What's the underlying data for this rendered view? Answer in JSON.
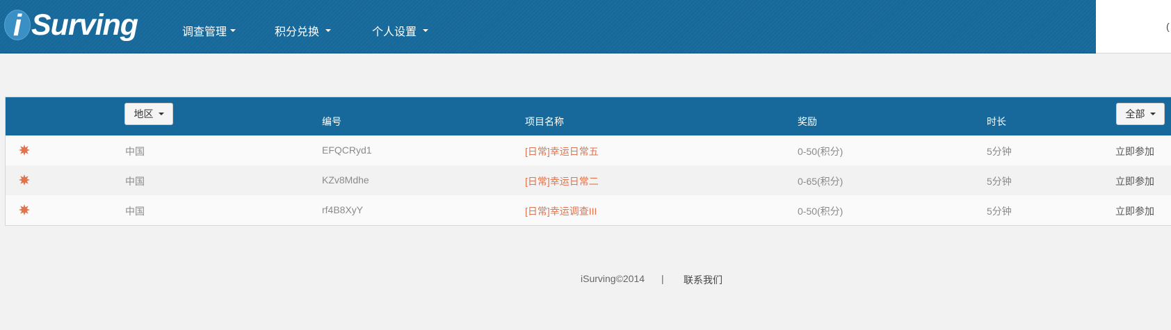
{
  "brand": {
    "logo_initial": "i",
    "logo_rest": "Surving"
  },
  "nav": [
    {
      "label": "调查管理"
    },
    {
      "label": "积分兑换"
    },
    {
      "label": "个人设置"
    }
  ],
  "header_right": {
    "edge_text": "("
  },
  "table": {
    "region_button": "地区",
    "filter_button": "全部",
    "columns": {
      "id": "编号",
      "name": "项目名称",
      "reward": "奖励",
      "duration": "时长"
    },
    "rows": [
      {
        "region": "中国",
        "id": "EFQCRyd1",
        "name": "[日常]幸运日常五",
        "reward": "0-50(积分)",
        "duration": "5分钟",
        "action": "立即参加"
      },
      {
        "region": "中国",
        "id": "KZv8Mdhe",
        "name": "[日常]幸运日常二",
        "reward": "0-65(积分)",
        "duration": "5分钟",
        "action": "立即参加"
      },
      {
        "region": "中国",
        "id": "rf4B8XyY",
        "name": "[日常]幸运调查III",
        "reward": "0-50(积分)",
        "duration": "5分钟",
        "action": "立即参加"
      }
    ]
  },
  "footer": {
    "copyright": "iSurving©2014",
    "separator": "|",
    "contact": "联系我们"
  },
  "colors": {
    "primary": "#16699a",
    "accent": "#e0744f",
    "background": "#f2f2f2"
  }
}
